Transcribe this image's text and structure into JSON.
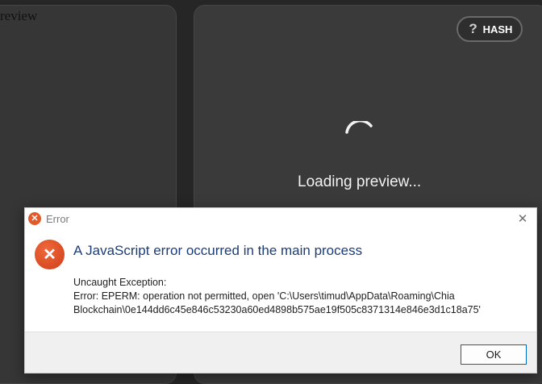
{
  "left_panel": {
    "partial_text": "review"
  },
  "hash_button": {
    "label": "HASH",
    "icon": "question-icon"
  },
  "loading": {
    "text": "Loading preview..."
  },
  "dialog": {
    "title": "Error",
    "main_instruction": "A JavaScript error occurred in the main process",
    "body_lines": [
      "Uncaught Exception:",
      "Error: EPERM: operation not permitted, open 'C:\\Users\\timud\\AppData\\Roaming\\Chia",
      "Blockchain\\0e144dd6c45e846c53230a60ed4898b575ae19f505c8371314e846e3d1c18a75'"
    ],
    "ok_label": "OK",
    "close_glyph": "✕",
    "icon_glyph": "✕"
  },
  "colors": {
    "background": "#262626",
    "card": "#363636",
    "error_icon": "#e05a2b",
    "instruction_text": "#1c3d7a",
    "ok_border": "#0067c0"
  }
}
